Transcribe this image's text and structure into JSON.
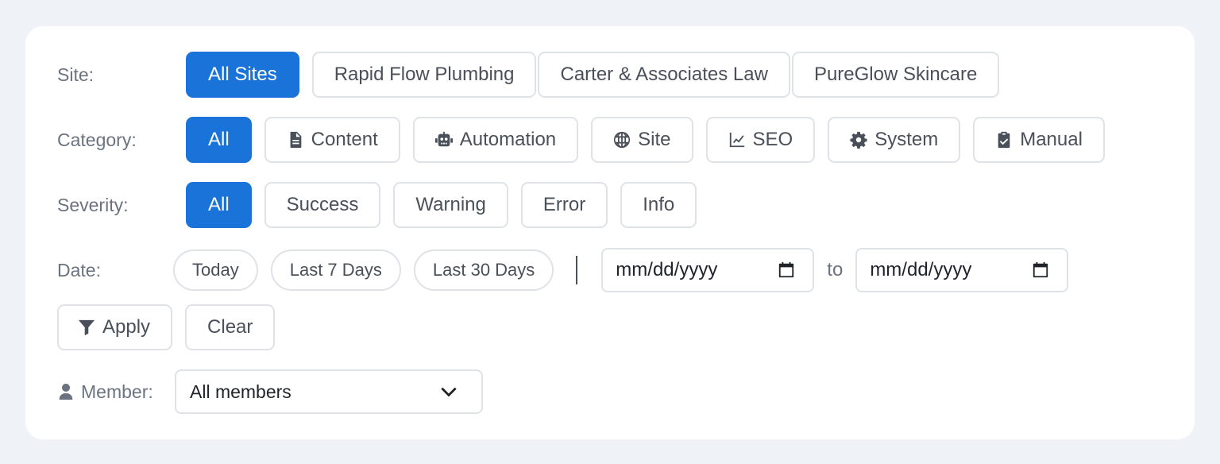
{
  "site": {
    "label": "Site:",
    "options": [
      "All Sites",
      "Rapid Flow Plumbing",
      "Carter & Associates Law",
      "PureGlow Skincare"
    ],
    "selected": "All Sites"
  },
  "category": {
    "label": "Category:",
    "options": [
      {
        "label": "All",
        "icon": ""
      },
      {
        "label": "Content",
        "icon": "file-icon"
      },
      {
        "label": "Automation",
        "icon": "robot-icon"
      },
      {
        "label": "Site",
        "icon": "globe-icon"
      },
      {
        "label": "SEO",
        "icon": "chart-line-icon"
      },
      {
        "label": "System",
        "icon": "gear-icon"
      },
      {
        "label": "Manual",
        "icon": "clipboard-check-icon"
      }
    ],
    "selected": "All"
  },
  "severity": {
    "label": "Severity:",
    "options": [
      "All",
      "Success",
      "Warning",
      "Error",
      "Info"
    ],
    "selected": "All"
  },
  "date": {
    "label": "Date:",
    "presets": [
      "Today",
      "Last 7 Days",
      "Last 30 Days"
    ],
    "from_placeholder": "mm/dd/yyyy",
    "to_label": "to",
    "to_placeholder": "mm/dd/yyyy"
  },
  "actions": {
    "apply_label": "Apply",
    "apply_icon": "filter-icon",
    "clear_label": "Clear"
  },
  "member": {
    "label": "Member:",
    "icon": "user-icon",
    "value": "All members"
  },
  "colors": {
    "accent": "#1a73d9",
    "border": "#dfe2e7",
    "background": "#eff2f7"
  }
}
